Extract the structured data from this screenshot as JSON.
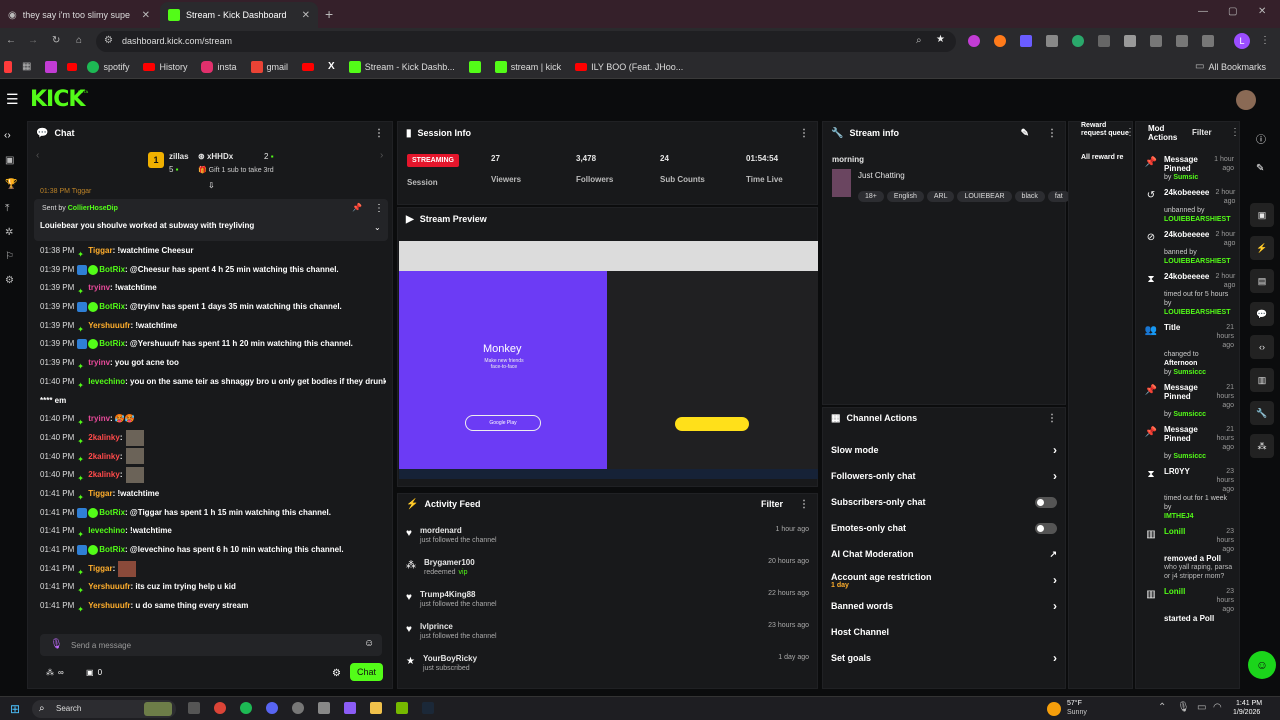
{
  "browser": {
    "tabs": [
      {
        "label": "they say i'm too slimy supe"
      },
      {
        "label": "Stream - Kick Dashboard"
      }
    ],
    "url": "dashboard.kick.com/stream",
    "avatar_letter": "L",
    "bookmarks": [
      "spotify",
      "History",
      "insta",
      "gmail",
      "Stream - Kick Dashb...",
      "stream | kick",
      "ILY BOO (Feat. JHoo..."
    ],
    "all_bookmarks": "All Bookmarks"
  },
  "brand": {
    "logo": "KICK",
    "logo_sup": "BETA",
    "accent": "#53fc18"
  },
  "chat": {
    "title": "Chat",
    "gifters": [
      {
        "rank": "1",
        "name": "zillas",
        "count": "5"
      },
      {
        "name": "xHHDx",
        "count": "2"
      }
    ],
    "gift_text": "Gift 1 sub to take 3rd",
    "top_partial": "01:38 PM Tiggar",
    "pinned": {
      "sent_by_prefix": "Sent by",
      "sender": "CollierHoseDip",
      "text": "Louiebear you shoulve worked at subway with treyliving"
    },
    "messages": [
      {
        "time": "01:38 PM",
        "user": "Tiggar",
        "color": "#ffae2c",
        "text": ": !watchtime Cheesur"
      },
      {
        "time": "01:39 PM",
        "user": "BotRix",
        "color": "#53fc18",
        "text": ": @Cheesur has spent 4 h 25 min watching this channel."
      },
      {
        "time": "01:39 PM",
        "user": "tryinv",
        "color": "#e84a9a",
        "text": ": !watchtime"
      },
      {
        "time": "01:39 PM",
        "user": "BotRix",
        "color": "#53fc18",
        "text": ": @tryinv has spent 1 days 35 min watching this channel."
      },
      {
        "time": "01:39 PM",
        "user": "Yershuuufr",
        "color": "#ffae2c",
        "text": ": !watchtime"
      },
      {
        "time": "01:39 PM",
        "user": "BotRix",
        "color": "#53fc18",
        "text": ": @Yershuuufr has spent 11 h 20 min watching this channel."
      },
      {
        "time": "01:39 PM",
        "user": "tryinv",
        "color": "#e84a9a",
        "text": ": you got acne too"
      },
      {
        "time": "01:40 PM",
        "user": "levechino",
        "color": "#53fc18",
        "text": ": you on the same teir as shnaggy bro u only get bodies if they drunk or u"
      },
      {
        "time": "",
        "user": "",
        "color": "#ffffff",
        "text": "**** em"
      },
      {
        "time": "01:40 PM",
        "user": "tryinv",
        "color": "#e84a9a",
        "text": ": 🥵🥵"
      },
      {
        "time": "01:40 PM",
        "user": "2kalinky",
        "color": "#ff4a4a",
        "text": ":"
      },
      {
        "time": "01:40 PM",
        "user": "2kalinky",
        "color": "#ff4a4a",
        "text": ":"
      },
      {
        "time": "01:40 PM",
        "user": "2kalinky",
        "color": "#ff4a4a",
        "text": ":"
      },
      {
        "time": "01:41 PM",
        "user": "Tiggar",
        "color": "#ffae2c",
        "text": ": !watchtime"
      },
      {
        "time": "01:41 PM",
        "user": "BotRix",
        "color": "#53fc18",
        "text": ": @Tiggar has spent 1 h 15 min watching this channel."
      },
      {
        "time": "01:41 PM",
        "user": "levechino",
        "color": "#53fc18",
        "text": ": !watchtime"
      },
      {
        "time": "01:41 PM",
        "user": "BotRix",
        "color": "#53fc18",
        "text": ": @levechino has spent 6 h 10 min watching this channel."
      },
      {
        "time": "01:41 PM",
        "user": "Tiggar",
        "color": "#ffae2c",
        "text": ":"
      },
      {
        "time": "01:41 PM",
        "user": "Yershuuufr",
        "color": "#ffae2c",
        "text": ": its cuz im trying help u kid"
      },
      {
        "time": "01:41 PM",
        "user": "Yershuuufr",
        "color": "#ffae2c",
        "text": ": u do same thing every stream"
      }
    ],
    "input_placeholder": "Send a message",
    "infinity": "∞",
    "count": "0",
    "send_label": "Chat"
  },
  "session": {
    "title": "Session Info",
    "status": "STREAMING",
    "session_label": "Session",
    "stats": [
      {
        "value": "27",
        "label": "Viewers"
      },
      {
        "value": "3,478",
        "label": "Followers"
      },
      {
        "value": "24",
        "label": "Sub Counts"
      },
      {
        "value": "01:54:54",
        "label": "Time Live"
      }
    ]
  },
  "preview": {
    "title": "Stream Preview",
    "monkey": "Monkey",
    "monkey_sub": "Make new friends face-to-face",
    "gplay": "Google Play"
  },
  "stream_info": {
    "title": "Stream info",
    "stream_title": "morning",
    "category": "Just Chatting",
    "tags": [
      "18+",
      "English",
      "ARL",
      "LOUIEBEAR",
      "black",
      "fat"
    ]
  },
  "channel_actions": {
    "title": "Channel Actions",
    "items": [
      {
        "label": "Slow mode",
        "kind": "chev"
      },
      {
        "label": "Followers-only chat",
        "kind": "chev"
      },
      {
        "label": "Subscribers-only chat",
        "kind": "toggle"
      },
      {
        "label": "Emotes-only chat",
        "kind": "toggle"
      },
      {
        "label": "AI Chat Moderation",
        "kind": "ext"
      },
      {
        "label": "Account age restriction",
        "sub": "1 day",
        "kind": "chev"
      },
      {
        "label": "Banned words",
        "kind": "chev"
      },
      {
        "label": "Host Channel",
        "kind": "none"
      },
      {
        "label": "Set goals",
        "kind": "chev"
      }
    ]
  },
  "activity": {
    "title": "Activity Feed",
    "filter": "Filter",
    "items": [
      {
        "user": "mordenard",
        "desc": "just followed the channel",
        "time": "1 hour ago",
        "icon": "heart-icon"
      },
      {
        "user": "Brygamer100",
        "desc": "redeemed",
        "extra": "vip",
        "time": "20 hours ago",
        "icon": "points-icon"
      },
      {
        "user": "Trump4King88",
        "desc": "just followed the channel",
        "time": "22 hours ago",
        "icon": "heart-icon"
      },
      {
        "user": "lvlprince",
        "desc": "just followed the channel",
        "time": "23 hours ago",
        "icon": "heart-icon"
      },
      {
        "user": "YourBoyRicky",
        "desc": "just subscribed",
        "time": "1 day ago",
        "icon": "star-icon"
      }
    ]
  },
  "reward": {
    "title": "Reward request queue",
    "sub": "All reward re"
  },
  "mod": {
    "title": "Mod Actions",
    "filter": "Filter",
    "items": [
      {
        "icon": "📌",
        "l1": "Message Pinned",
        "time": "1 hour ago",
        "by": "by",
        "who": "Sumsic",
        "whoColor": "#53fc18"
      },
      {
        "icon": "↺",
        "l1": "24kobeeeee",
        "time": "2 hour ago",
        "l2": "unbanned by",
        "who": "LOUIEBEARSHIEST",
        "whoColor": "#53fc18"
      },
      {
        "icon": "⊘",
        "l1": "24kobeeeee",
        "time": "2 hour ago",
        "l2": "banned by",
        "who": "LOUIEBEARSHIEST",
        "whoColor": "#53fc18"
      },
      {
        "icon": "⧗",
        "l1": "24kobeeeee",
        "time": "2 hour ago",
        "l2": "timed out for 5 hours by",
        "who": "LOUIEBEARSHIEST",
        "whoColor": "#53fc18"
      },
      {
        "icon": "👥",
        "l1": "Title",
        "time": "21 hours ago",
        "l2": "changed to",
        "l3": "Afternoon",
        "by": "by",
        "who": "Sumsiccc",
        "whoColor": "#53fc18"
      },
      {
        "icon": "📌",
        "l1": "Message Pinned",
        "time": "21 hours ago",
        "by": "by",
        "who": "Sumsiccc",
        "whoColor": "#53fc18"
      },
      {
        "icon": "📌",
        "l1": "Message Pinned",
        "time": "21 hours ago",
        "by": "by",
        "who": "Sumsiccc",
        "whoColor": "#53fc18"
      },
      {
        "icon": "⧗",
        "l1": "LR0YY",
        "time": "23 hours ago",
        "l2": "timed out for 1 week by",
        "who": "IMTHEJ4",
        "whoColor": "#53fc18"
      },
      {
        "icon": "▥",
        "l1": "Lonill",
        "l1Color": "#53fc18",
        "time": "23 hours ago",
        "l2": "removed a Poll",
        "l3": "who yall raping, parsa or j4 stripper mom?"
      },
      {
        "icon": "▥",
        "l1": "Lonill",
        "l1Color": "#53fc18",
        "time": "23 hours ago",
        "l2": "started a Poll"
      }
    ]
  },
  "taskbar": {
    "search": "Search",
    "weather_temp": "57°F",
    "weather_desc": "Sunny",
    "time": "1:41 PM",
    "date": "1/9/2026"
  }
}
